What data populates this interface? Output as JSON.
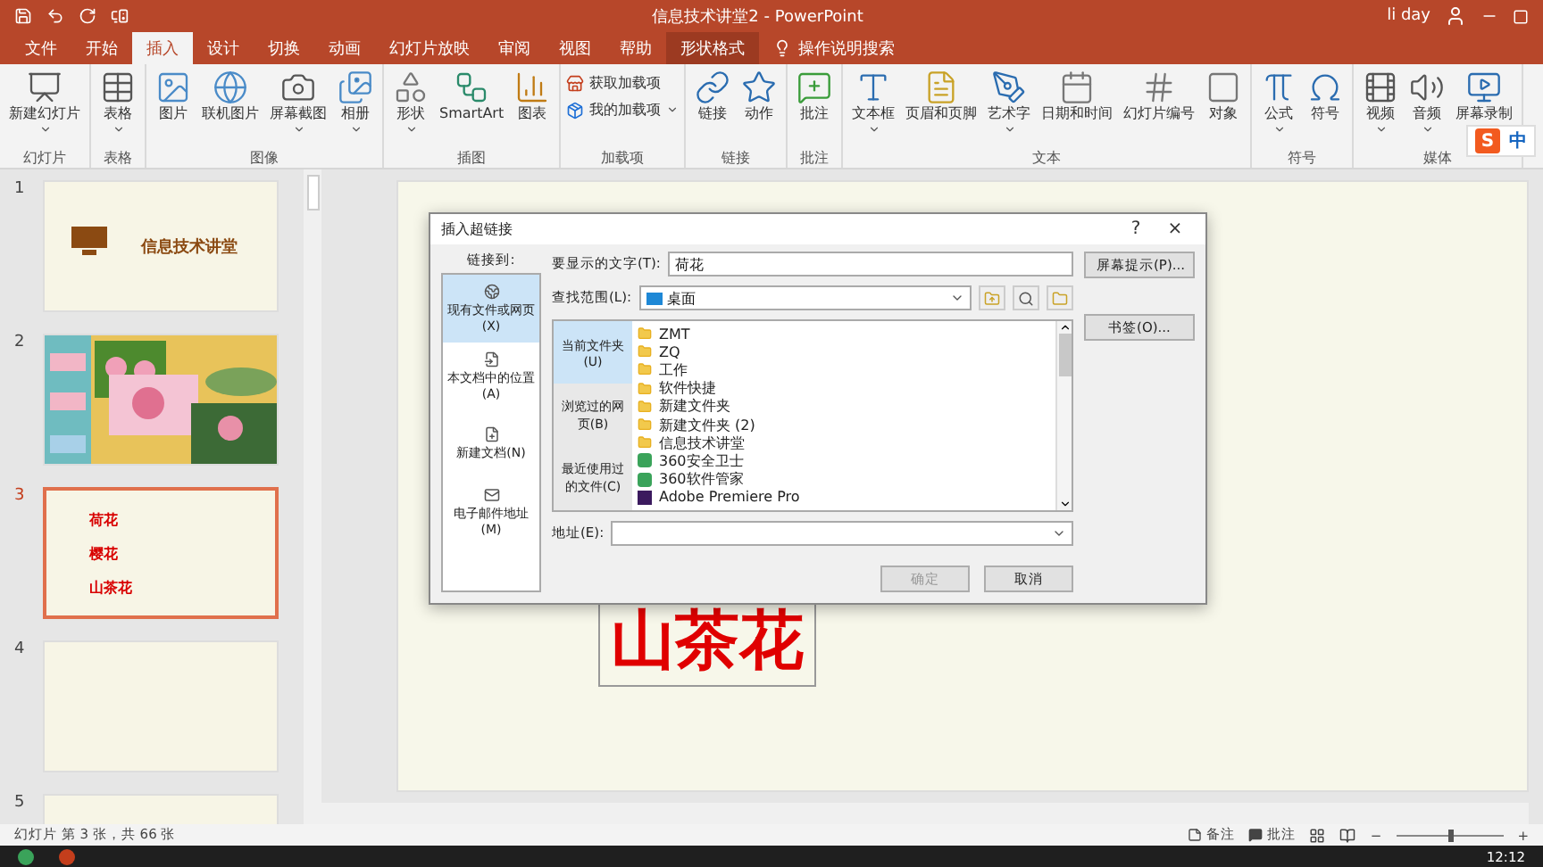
{
  "window": {
    "title": "信息技术讲堂2 - PowerPoint",
    "user": "li day"
  },
  "tabs": [
    {
      "label": "文件",
      "selected": false,
      "contextual": false
    },
    {
      "label": "开始",
      "selected": false,
      "contextual": false
    },
    {
      "label": "插入",
      "selected": true,
      "contextual": false
    },
    {
      "label": "设计",
      "selected": false,
      "contextual": false
    },
    {
      "label": "切换",
      "selected": false,
      "contextual": false
    },
    {
      "label": "动画",
      "selected": false,
      "contextual": false
    },
    {
      "label": "幻灯片放映",
      "selected": false,
      "contextual": false
    },
    {
      "label": "审阅",
      "selected": false,
      "contextual": false
    },
    {
      "label": "视图",
      "selected": false,
      "contextual": false
    },
    {
      "label": "帮助",
      "selected": false,
      "contextual": false
    },
    {
      "label": "形状格式",
      "selected": false,
      "contextual": true
    }
  ],
  "tell_me": "操作说明搜索",
  "ribbon": [
    {
      "label": "幻灯片",
      "items": [
        {
          "label": "新建幻灯片",
          "kind": "large",
          "dropdown": true
        }
      ]
    },
    {
      "label": "表格",
      "items": [
        {
          "label": "表格",
          "kind": "large",
          "dropdown": true
        }
      ]
    },
    {
      "label": "图像",
      "items": [
        {
          "label": "图片",
          "kind": "large",
          "dropdown": false
        },
        {
          "label": "联机图片",
          "kind": "large",
          "dropdown": false
        },
        {
          "label": "屏幕截图",
          "kind": "large",
          "dropdown": true
        },
        {
          "label": "相册",
          "kind": "large",
          "dropdown": true
        }
      ]
    },
    {
      "label": "插图",
      "items": [
        {
          "label": "形状",
          "kind": "large",
          "dropdown": true
        },
        {
          "label": "SmartArt",
          "kind": "large",
          "dropdown": false
        },
        {
          "label": "图表",
          "kind": "large",
          "dropdown": false
        }
      ]
    },
    {
      "label": "加载项",
      "items": [
        {
          "label": "获取加载项",
          "kind": "small",
          "dropdown": false
        },
        {
          "label": "我的加载项",
          "kind": "small",
          "dropdown": true
        }
      ]
    },
    {
      "label": "链接",
      "items": [
        {
          "label": "链接",
          "kind": "large",
          "dropdown": false
        },
        {
          "label": "动作",
          "kind": "large",
          "dropdown": false
        }
      ]
    },
    {
      "label": "批注",
      "items": [
        {
          "label": "批注",
          "kind": "large",
          "dropdown": false
        }
      ]
    },
    {
      "label": "文本",
      "items": [
        {
          "label": "文本框",
          "kind": "large",
          "dropdown": true
        },
        {
          "label": "页眉和页脚",
          "kind": "large",
          "dropdown": false
        },
        {
          "label": "艺术字",
          "kind": "large",
          "dropdown": true
        },
        {
          "label": "日期和时间",
          "kind": "large",
          "dropdown": false
        },
        {
          "label": "幻灯片编号",
          "kind": "large",
          "dropdown": false
        },
        {
          "label": "对象",
          "kind": "large",
          "dropdown": false
        }
      ]
    },
    {
      "label": "符号",
      "items": [
        {
          "label": "公式",
          "kind": "large",
          "dropdown": true
        },
        {
          "label": "符号",
          "kind": "large",
          "dropdown": false
        }
      ]
    },
    {
      "label": "媒体",
      "items": [
        {
          "label": "视频",
          "kind": "large",
          "dropdown": true
        },
        {
          "label": "音频",
          "kind": "large",
          "dropdown": true
        },
        {
          "label": "屏幕录制",
          "kind": "large",
          "dropdown": false
        }
      ]
    }
  ],
  "ime": {
    "logo": "S",
    "mode": "中"
  },
  "slides": [
    {
      "number": "1",
      "selected": false,
      "kind": "title",
      "texts": [
        "信息技术讲堂"
      ]
    },
    {
      "number": "2",
      "selected": false,
      "kind": "picture"
    },
    {
      "number": "3",
      "selected": true,
      "kind": "list",
      "texts": [
        "荷花",
        "樱花",
        "山茶花"
      ]
    },
    {
      "number": "4",
      "selected": false,
      "kind": "blank"
    },
    {
      "number": "5",
      "selected": false,
      "kind": "blank"
    }
  ],
  "slide_text": "山茶花",
  "dialog": {
    "title": "插入超链接",
    "help": "?",
    "close": "×",
    "link_to_label": "链接到:",
    "link_to": [
      {
        "label": "现有文件或网页(X)",
        "selected": true
      },
      {
        "label": "本文档中的位置(A)",
        "selected": false
      },
      {
        "label": "新建文档(N)",
        "selected": false
      },
      {
        "label": "电子邮件地址(M)",
        "selected": false
      }
    ],
    "display_text_label": "要显示的文字(T):",
    "display_text": "荷花",
    "screen_tip": "屏幕提示(P)...",
    "look_in_label": "查找范围(L):",
    "look_in": "桌面",
    "sources": [
      {
        "label": "当前文件夹(U)",
        "selected": true
      },
      {
        "label": "浏览过的网页(B)",
        "selected": false
      },
      {
        "label": "最近使用过的文件(C)",
        "selected": false
      }
    ],
    "files": [
      {
        "name": "ZMT",
        "kind": "folder"
      },
      {
        "name": "ZQ",
        "kind": "folder"
      },
      {
        "name": "工作",
        "kind": "folder"
      },
      {
        "name": "软件快捷",
        "kind": "folder"
      },
      {
        "name": "新建文件夹",
        "kind": "folder"
      },
      {
        "name": "新建文件夹 (2)",
        "kind": "folder"
      },
      {
        "name": "信息技术讲堂",
        "kind": "folder"
      },
      {
        "name": "360安全卫士",
        "kind": "shortcut"
      },
      {
        "name": "360软件管家",
        "kind": "shortcut"
      },
      {
        "name": "Adobe Premiere Pro",
        "kind": "app"
      }
    ],
    "bookmark": "书签(O)...",
    "address_label": "地址(E):",
    "ok": {
      "label": "确定",
      "disabled": true
    },
    "cancel": {
      "label": "取消",
      "disabled": false
    }
  },
  "status_bar": {
    "slide_info": "幻灯片 第 3 张，共 66 张",
    "notes": "备注",
    "comments": "批注",
    "zoom_out": "−",
    "zoom_in": "+",
    "zoom": {
      "level": 0.5
    }
  },
  "taskbar": {
    "time": "12:12"
  }
}
